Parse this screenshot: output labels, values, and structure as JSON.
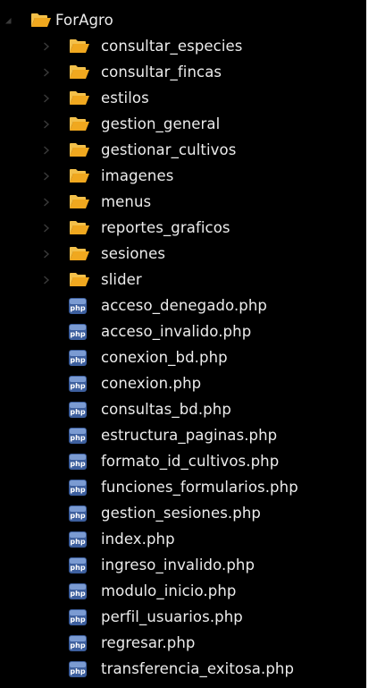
{
  "tree": {
    "root": {
      "label": "ForAgro",
      "icon": "folder-open-icon",
      "expanded": true
    },
    "folders": [
      {
        "label": "consultar_especies"
      },
      {
        "label": "consultar_fincas"
      },
      {
        "label": "estilos"
      },
      {
        "label": "gestion_general"
      },
      {
        "label": "gestionar_cultivos"
      },
      {
        "label": "imagenes"
      },
      {
        "label": "menus"
      },
      {
        "label": "reportes_graficos"
      },
      {
        "label": "sesiones"
      },
      {
        "label": "slider"
      }
    ],
    "files": [
      {
        "label": "acceso_denegado.php"
      },
      {
        "label": "acceso_invalido.php"
      },
      {
        "label": "conexion_bd.php"
      },
      {
        "label": "conexion.php"
      },
      {
        "label": "consultas_bd.php"
      },
      {
        "label": "estructura_paginas.php"
      },
      {
        "label": "formato_id_cultivos.php"
      },
      {
        "label": "funciones_formularios.php"
      },
      {
        "label": "gestion_sesiones.php"
      },
      {
        "label": "index.php"
      },
      {
        "label": "ingreso_invalido.php"
      },
      {
        "label": "modulo_inicio.php"
      },
      {
        "label": "perfil_usuarios.php"
      },
      {
        "label": "regresar.php"
      },
      {
        "label": "transferencia_exitosa.php"
      }
    ],
    "file_badge": "php"
  },
  "colors": {
    "background": "#000000",
    "text": "#ececec",
    "folder": "#f0b72f",
    "chevron": "#3a3a3a",
    "php_badge": "#4a6fb0"
  }
}
